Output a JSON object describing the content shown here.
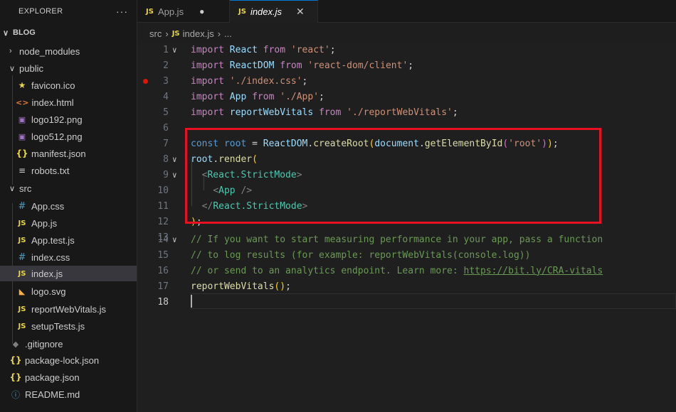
{
  "explorer": {
    "title": "EXPLORER",
    "more": "···",
    "items": [
      {
        "label": "BLOG",
        "chevron": "∨",
        "icon": ""
      },
      {
        "label": "node_modules",
        "chevron": "›",
        "icon": ""
      },
      {
        "label": "public",
        "chevron": "∨",
        "icon": ""
      },
      {
        "label": "favicon.ico",
        "chevron": "",
        "icon": "★"
      },
      {
        "label": "index.html",
        "chevron": "",
        "icon": "<>"
      },
      {
        "label": "logo192.png",
        "chevron": "",
        "icon": "▣"
      },
      {
        "label": "logo512.png",
        "chevron": "",
        "icon": "▣"
      },
      {
        "label": "manifest.json",
        "chevron": "",
        "icon": "{}"
      },
      {
        "label": "robots.txt",
        "chevron": "",
        "icon": "≡"
      },
      {
        "label": "src",
        "chevron": "∨",
        "icon": ""
      },
      {
        "label": "App.css",
        "chevron": "",
        "icon": "#"
      },
      {
        "label": "App.js",
        "chevron": "",
        "icon": "JS"
      },
      {
        "label": "App.test.js",
        "chevron": "",
        "icon": "JS"
      },
      {
        "label": "index.css",
        "chevron": "",
        "icon": "#"
      },
      {
        "label": "index.js",
        "chevron": "",
        "icon": "JS"
      },
      {
        "label": "logo.svg",
        "chevron": "",
        "icon": "◣"
      },
      {
        "label": "reportWebVitals.js",
        "chevron": "",
        "icon": "JS"
      },
      {
        "label": "setupTests.js",
        "chevron": "",
        "icon": "JS"
      },
      {
        "label": ".gitignore",
        "chevron": "",
        "icon": "◆"
      },
      {
        "label": "package-lock.json",
        "chevron": "",
        "icon": "{}"
      },
      {
        "label": "package.json",
        "chevron": "",
        "icon": "{}"
      },
      {
        "label": "README.md",
        "chevron": "",
        "icon": "ⓘ"
      }
    ]
  },
  "tabs": [
    {
      "icon": "JS",
      "label": "App.js",
      "status": "●"
    },
    {
      "icon": "JS",
      "label": "index.js",
      "status": "✕"
    }
  ],
  "breadcrumb": {
    "folder": "src",
    "separator": "›",
    "file_icon": "JS",
    "file": "index.js",
    "tail": "..."
  },
  "editor": {
    "line_numbers": [
      "1",
      "2",
      "3",
      "4",
      "5",
      "6",
      "7",
      "8",
      "9",
      "10",
      "11",
      "12",
      "13",
      "14",
      "15",
      "16",
      "17",
      "18"
    ],
    "fold_marker": "∨",
    "code": {
      "l1": {
        "kw": "import",
        "name": "React",
        "from": "from",
        "str": "'react'",
        "semi": ";"
      },
      "l2": {
        "kw": "import",
        "name": "ReactDOM",
        "from": "from",
        "str": "'react-dom/client'",
        "semi": ";"
      },
      "l3": {
        "kw": "import",
        "str": "'./index.css'",
        "semi": ";"
      },
      "l4": {
        "kw": "import",
        "name": "App",
        "from": "from",
        "str": "'./App'",
        "semi": ";"
      },
      "l5": {
        "kw": "import",
        "name": "reportWebVitals",
        "from": "from",
        "str": "'./reportWebVitals'",
        "semi": ";"
      },
      "l7": {
        "kw": "const",
        "var": "root",
        "eq": " = ",
        "obj": "ReactDOM",
        "dot": ".",
        "fn": "createRoot",
        "p1": "(",
        "obj2": "document",
        "dot2": ".",
        "fn2": "getElementById",
        "p2": "(",
        "str": "'root'",
        "p2c": ")",
        "p1c": ")",
        "semi": ";"
      },
      "l8": {
        "var": "root",
        "dot": ".",
        "fn": "render",
        "p": "("
      },
      "l9": {
        "open": "<",
        "tag": "React.StrictMode",
        "close": ">"
      },
      "l10": {
        "open": "<",
        "tag": "App",
        "close": " />"
      },
      "l11": {
        "open": "</",
        "tag": "React.StrictMode",
        "close": ">"
      },
      "l12": {
        "p": ")",
        "semi": ";"
      },
      "l14": "// If you want to start measuring performance in your app, pass a function",
      "l15": "// to log results (for example: reportWebVitals(console.log))",
      "l16": {
        "text": "// or send to an analytics endpoint. Learn more: ",
        "link": "https://bit.ly/CRA-vitals"
      },
      "l17": {
        "fn": "reportWebVitals",
        "p": "()",
        "semi": ";"
      }
    }
  },
  "colors": {
    "highlight_box": "#e81123",
    "breakpoint": "#e51400",
    "accent": "#0078d4"
  }
}
